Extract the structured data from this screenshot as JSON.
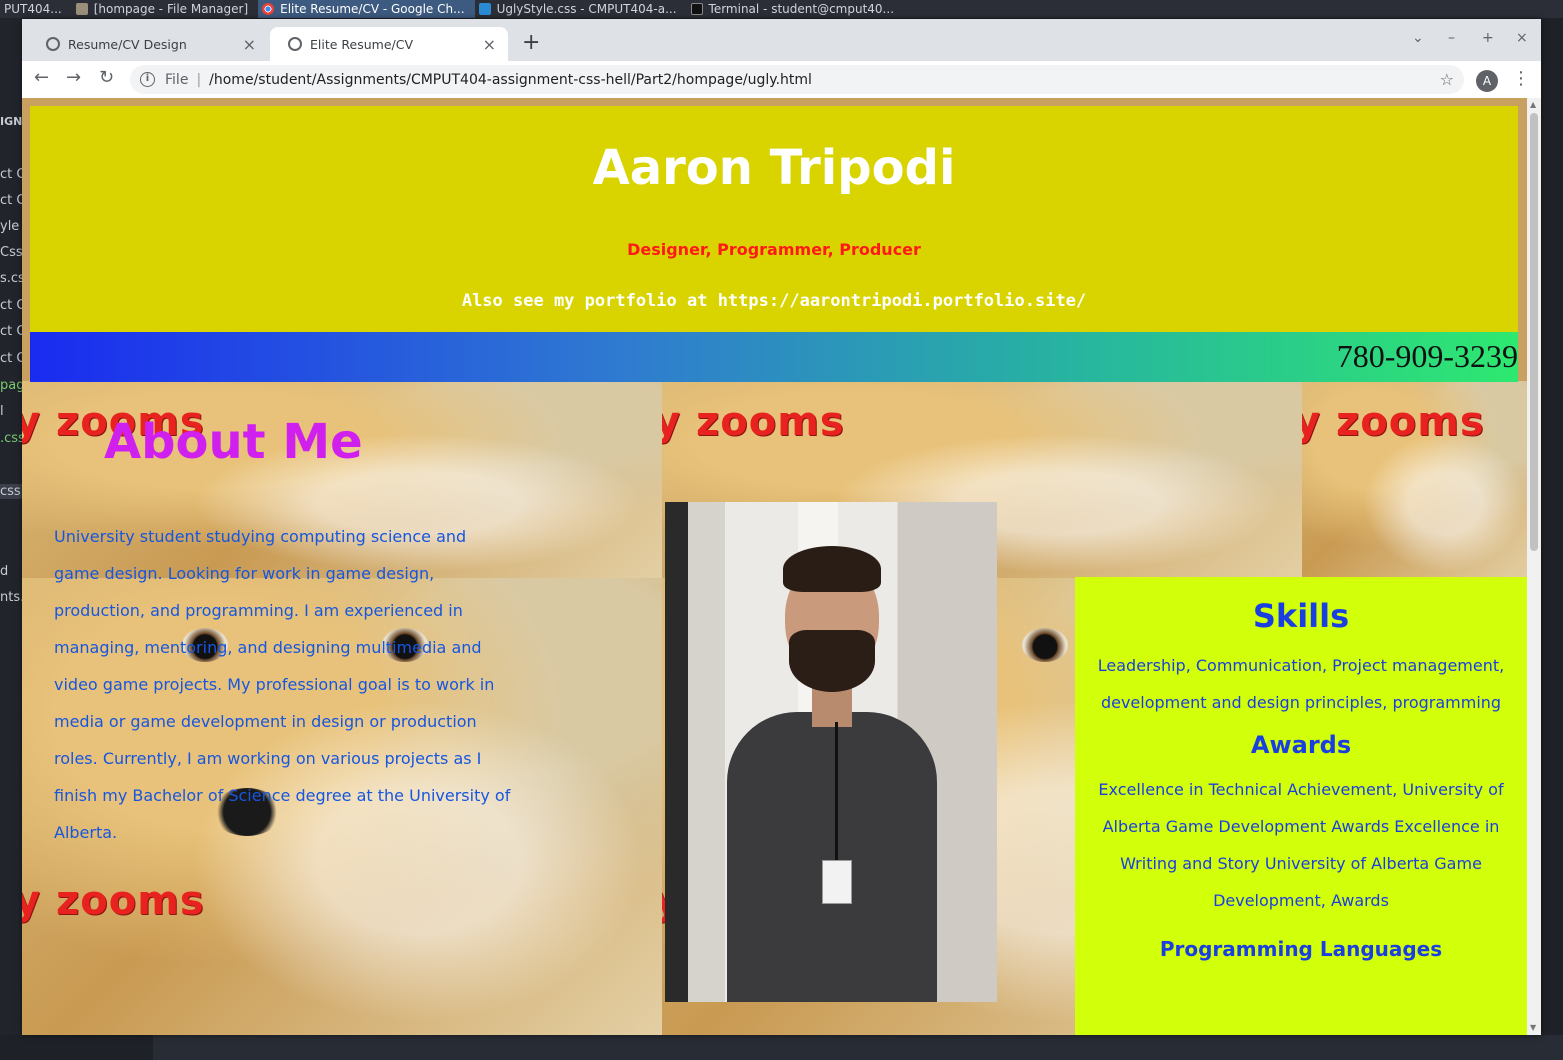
{
  "taskbar": {
    "items": [
      {
        "label": "PUT404..."
      },
      {
        "label": "[hompage - File Manager]"
      },
      {
        "label": "Elite Resume/CV - Google Ch..."
      },
      {
        "label": "UglyStyle.css - CMPUT404-a..."
      },
      {
        "label": "Terminal - student@cmput40..."
      }
    ]
  },
  "background_editor": {
    "lines": [
      "IGN",
      "ct G",
      "ct G",
      "yle",
      "Css.",
      "s.cs",
      "ct G",
      "ct G",
      "ct G",
      "pag",
      "l",
      ".css",
      "css",
      "d",
      "nts."
    ]
  },
  "browser": {
    "tabs": [
      {
        "label": "Resume/CV Design"
      },
      {
        "label": "Elite Resume/CV"
      }
    ],
    "new_tab": "+",
    "address": {
      "scheme_label": "File",
      "url": "/home/student/Assignments/CMPUT404-assignment-css-hell/Part2/hompage/ugly.html"
    },
    "profile_initial": "A"
  },
  "page": {
    "header": {
      "name": "Aaron Tripodi",
      "tagline": "Designer, Programmer, Producer",
      "portfolio": "Also see my portfolio at https://aarontripodi.portfolio.site/"
    },
    "phone": "780-909-3239",
    "background_text": "y zooms",
    "about": {
      "title": "About Me",
      "text": "University student studying computing science and game design. Looking for work in game design, production, and programming. I am experienced in managing, mentoring, and designing  multimedia and video game projects. My professional goal is to  work in media or game development in design or production roles.  Currently, I am working on various projects as I finish my  Bachelor of Science degree at the University of Alberta."
    },
    "skills": {
      "title": "Skills",
      "text": "Leadership, Communication, Project  management, development and design  principles, programming"
    },
    "awards": {
      "title": "Awards",
      "text": "Excellence in Technical  Achievement,  University  of Alberta Game  Development Awards  Excellence in Writing and  Story University of Alberta  Game Development,  Awards"
    },
    "languages": {
      "title": "Programming Languages"
    }
  },
  "colors": {
    "header_bg": "#d9d400",
    "tagline": "#ff1a1a",
    "about_title": "#d020f0",
    "body_text": "#1656e0",
    "panel_bg": "#d2ff0a"
  }
}
